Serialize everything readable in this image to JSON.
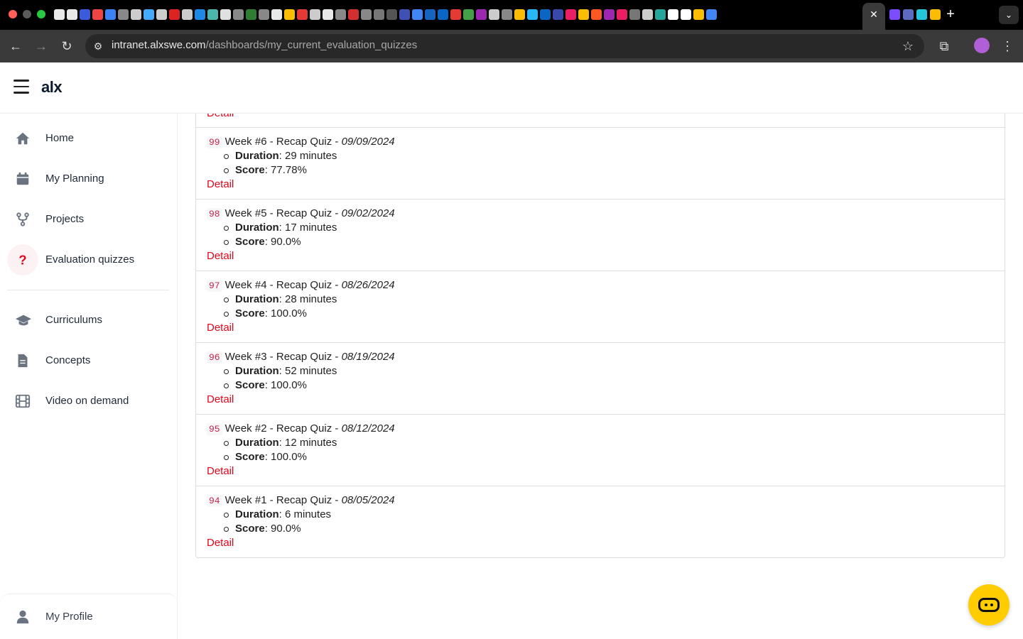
{
  "browser": {
    "url_host": "intranet.alxswe.com",
    "url_path": "/dashboards/my_current_evaluation_quizzes",
    "tab_icon_colors": [
      "#e8e8e8",
      "#e8e8e8",
      "#3b5bdb",
      "#e44",
      "#3b82f6",
      "#888",
      "#ccc",
      "#4af",
      "#ccc",
      "#d22",
      "#ccc",
      "#1e88e5",
      "#4db6ac",
      "#e0e0e0",
      "#888",
      "#2e7d32",
      "#888",
      "#e8e8e8",
      "#fbbc04",
      "#e53935",
      "#ccc",
      "#e8e8e8",
      "#888",
      "#d32f2f",
      "#888",
      "#777",
      "#555",
      "#3f51b5",
      "#4285f4",
      "#1565c0",
      "#0a66c2",
      "#e53935",
      "#43a047",
      "#9c27b0",
      "#ccc",
      "#888",
      "#fbbc04",
      "#29b6f6",
      "#0a66c2",
      "#3949ab",
      "#e91e63",
      "#fbbc04",
      "#ff5722",
      "#9c27b0",
      "#e91e63",
      "#777",
      "#ccc",
      "#26a69a",
      "#ffffff",
      "#ffffff",
      "#fbbc04",
      "#4285f4"
    ],
    "tab_icon_colors_right": [
      "#7c4dff",
      "#5c6bc0",
      "#26c6da",
      "#fbbc04"
    ]
  },
  "app": {
    "logo": "alx"
  },
  "sidebar": {
    "items": [
      {
        "label": "Home",
        "icon": "home-icon"
      },
      {
        "label": "My Planning",
        "icon": "calendar-icon"
      },
      {
        "label": "Projects",
        "icon": "fork-icon"
      },
      {
        "label": "Evaluation quizzes",
        "icon": "question-icon",
        "active": true
      },
      {
        "label": "Curriculums",
        "icon": "graduation-cap-icon"
      },
      {
        "label": "Concepts",
        "icon": "document-icon"
      },
      {
        "label": "Video on demand",
        "icon": "film-icon"
      }
    ],
    "profile_label": "My Profile"
  },
  "quizzes": {
    "top_detail_label": "Detail",
    "duration_label": "Duration",
    "score_label": "Score",
    "detail_label": "Detail",
    "items": [
      {
        "num": "99",
        "title": "Week #6 - Recap Quiz - ",
        "date": "09/09/2024",
        "duration": ": 29 minutes",
        "score": ": 77.78%"
      },
      {
        "num": "98",
        "title": "Week #5 - Recap Quiz - ",
        "date": "09/02/2024",
        "duration": ": 17 minutes",
        "score": ": 90.0%"
      },
      {
        "num": "97",
        "title": "Week #4 - Recap Quiz - ",
        "date": "08/26/2024",
        "duration": ": 28 minutes",
        "score": ": 100.0%"
      },
      {
        "num": "96",
        "title": "Week #3 - Recap Quiz - ",
        "date": "08/19/2024",
        "duration": ": 52 minutes",
        "score": ": 100.0%"
      },
      {
        "num": "95",
        "title": "Week #2 - Recap Quiz - ",
        "date": "08/12/2024",
        "duration": ": 12 minutes",
        "score": ": 100.0%"
      },
      {
        "num": "94",
        "title": "Week #1 - Recap Quiz - ",
        "date": "08/05/2024",
        "duration": ": 6 minutes",
        "score": ": 90.0%"
      }
    ]
  },
  "colors": {
    "accent": "#e3061b",
    "chat": "#ffcc00"
  }
}
